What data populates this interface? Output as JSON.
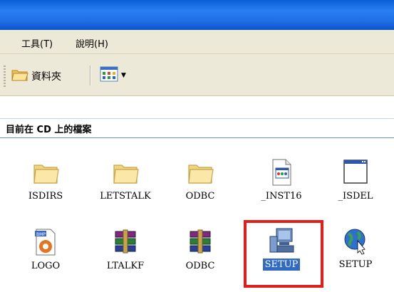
{
  "menu": {
    "tools": "工具(T)",
    "help": "說明(H)"
  },
  "toolbar": {
    "folders_label": "資料夾",
    "views_icon": "views-icon",
    "views_arrow_icon": "dropdown-arrow-icon"
  },
  "section": {
    "title": "目前在 CD 上的檔案"
  },
  "highlight_color": "#e31c1c",
  "selection_color": "#316ac5",
  "files": [
    {
      "name": "ISDIRS",
      "icon": "folder-icon"
    },
    {
      "name": "LETSTALK",
      "icon": "folder-icon"
    },
    {
      "name": "ODBC",
      "icon": "folder-icon"
    },
    {
      "name": "_INST16",
      "icon": "app-window-icon"
    },
    {
      "name": "_ISDEL",
      "icon": "blank-window-icon"
    },
    {
      "name": "LOGO",
      "icon": "bmp-image-icon"
    },
    {
      "name": "LTALKF",
      "icon": "winrar-archive-icon"
    },
    {
      "name": "ODBC",
      "icon": "winrar-archive-icon"
    },
    {
      "name": "SETUP",
      "icon": "setup-computer-icon",
      "selected": true
    },
    {
      "name": "SETUP",
      "icon": "setup-globe-icon"
    }
  ]
}
